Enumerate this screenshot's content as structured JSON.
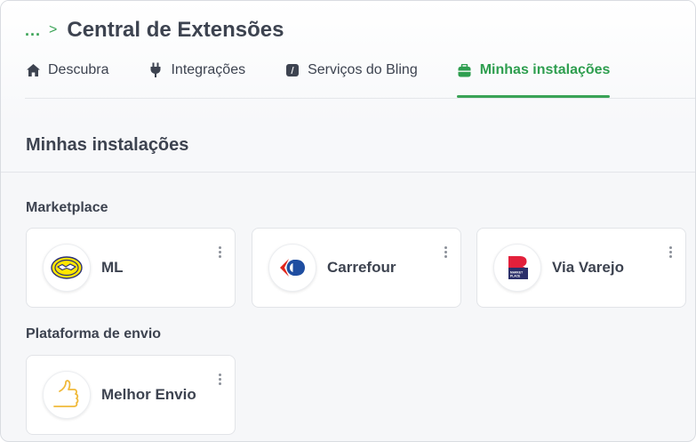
{
  "breadcrumb": {
    "ellipsis": "...",
    "separator": ">"
  },
  "page_title": "Central de Extensões",
  "tabs": [
    {
      "label": "Descubra",
      "icon": "home-icon",
      "active": false
    },
    {
      "label": "Integrações",
      "icon": "plug-icon",
      "active": false
    },
    {
      "label": "Serviços do Bling",
      "icon": "bling-icon",
      "active": false
    },
    {
      "label": "Minhas instalações",
      "icon": "briefcase-icon",
      "active": true
    }
  ],
  "section_title": "Minhas instalações",
  "groups": [
    {
      "title": "Marketplace",
      "items": [
        {
          "name": "ML",
          "logo": "mercado-livre-logo-icon"
        },
        {
          "name": "Carrefour",
          "logo": "carrefour-logo-icon"
        },
        {
          "name": "Via Varejo",
          "logo": "via-varejo-logo-icon"
        }
      ]
    },
    {
      "title": "Plataforma de envio",
      "items": [
        {
          "name": "Melhor Envio",
          "logo": "melhor-envio-logo-icon"
        }
      ]
    }
  ],
  "logo_text": {
    "via_varejo_small": "MARKET PLACE"
  },
  "colors": {
    "accent": "#3aa356",
    "text": "#3d4350",
    "background": "#f6f7f9"
  }
}
